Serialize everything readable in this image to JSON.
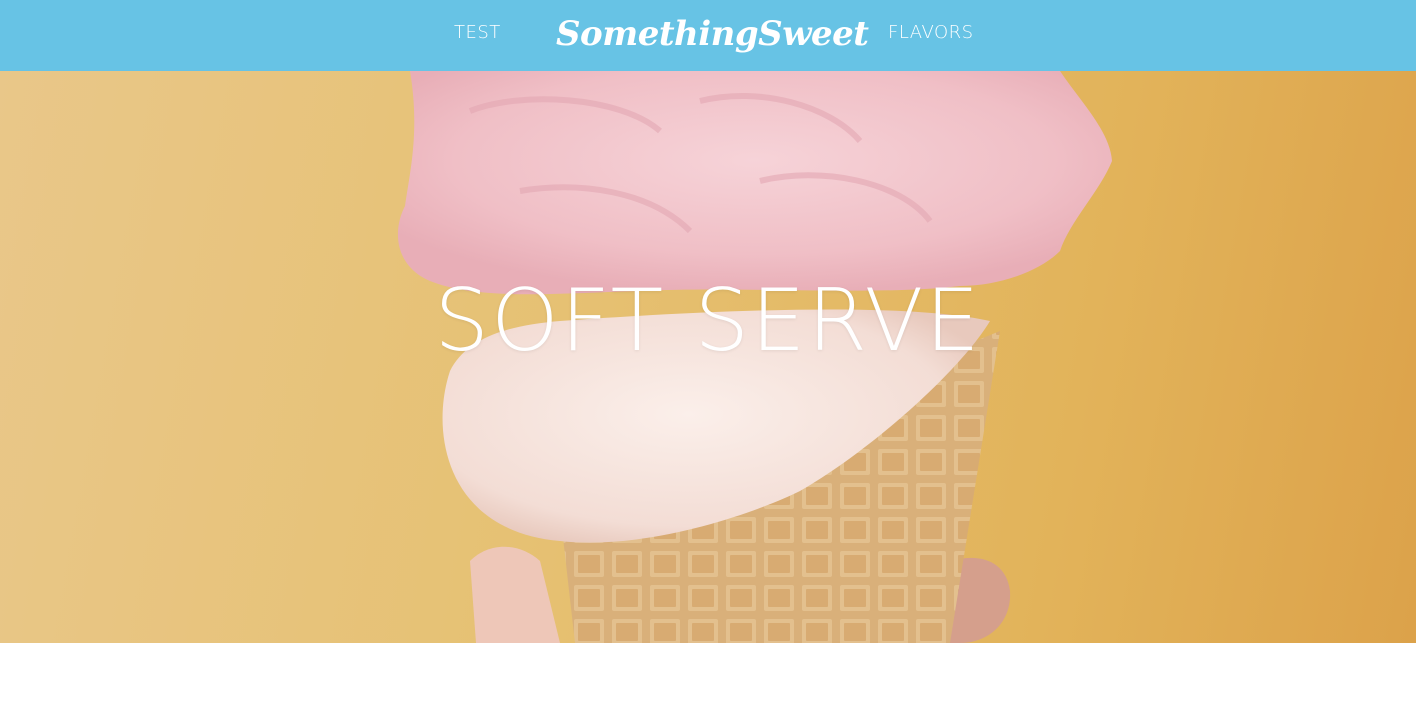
{
  "nav": {
    "left_link": "TEST",
    "brand": "SomethingSweet",
    "right_link": "FLAVORS"
  },
  "hero": {
    "title": "SOFT SERVE",
    "image": "ice-cream-cone-photo"
  },
  "colors": {
    "nav_background": "#67c3e5",
    "hero_background": "#e6c173",
    "text": "#ffffff"
  }
}
